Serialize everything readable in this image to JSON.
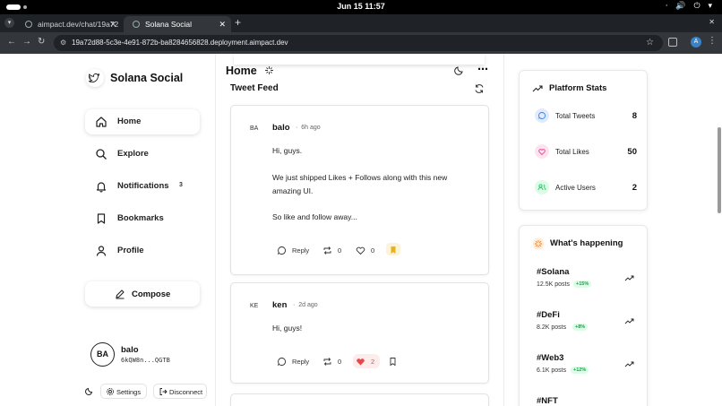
{
  "os": {
    "clock": "Jun 15  11:57",
    "tray": "⋅ 🔊 ⏻ ▾"
  },
  "browser": {
    "tabs": [
      {
        "label": "aimpact.dev/chat/19a72"
      },
      {
        "label": "Solana Social"
      }
    ],
    "url": "19a72d88-5c3e-4e91-872b-ba8284656828.deployment.aimpact.dev",
    "profile_initial": "A"
  },
  "sidebar": {
    "brand": "Solana Social",
    "items": [
      {
        "label": "Home",
        "icon": "home-icon"
      },
      {
        "label": "Explore",
        "icon": "search-icon"
      },
      {
        "label": "Notifications",
        "icon": "bell-icon",
        "badge": "3"
      },
      {
        "label": "Bookmarks",
        "icon": "bookmark-icon"
      },
      {
        "label": "Profile",
        "icon": "user-icon"
      }
    ],
    "compose_label": "Compose",
    "user": {
      "initials": "BA",
      "name": "balo",
      "address": "6kQW8n...QGTB"
    },
    "settings_label": "Settings",
    "disconnect_label": "Disconnect"
  },
  "main": {
    "title": "Home",
    "feed_title": "Tweet Feed",
    "tweets": [
      {
        "initials": "BA",
        "author": "balo",
        "time": "6h ago",
        "lines": [
          "Hi, guys.",
          "We just shipped Likes + Follows along with this new",
          "amazing UI.",
          "So like and follow away..."
        ],
        "reply_label": "Reply",
        "retweets": "0",
        "likes": "0"
      },
      {
        "initials": "KE",
        "author": "ken",
        "time": "2d ago",
        "lines": [
          "Hi, guys!"
        ],
        "reply_label": "Reply",
        "retweets": "0",
        "likes": "2"
      }
    ]
  },
  "stats": {
    "title": "Platform Stats",
    "rows": [
      {
        "label": "Total Tweets",
        "value": "8"
      },
      {
        "label": "Total Likes",
        "value": "50"
      },
      {
        "label": "Active Users",
        "value": "2"
      }
    ]
  },
  "trending": {
    "title": "What's happening",
    "items": [
      {
        "tag": "#Solana",
        "posts": "12.5K posts",
        "change": "+15%"
      },
      {
        "tag": "#DeFi",
        "posts": "8.2K posts",
        "change": "+8%"
      },
      {
        "tag": "#Web3",
        "posts": "6.1K posts",
        "change": "+12%"
      },
      {
        "tag": "#NFT"
      }
    ]
  },
  "colors": {
    "like_red": "#e5484d",
    "bookmark_gold": "#e9b21c",
    "stat_blue": "#3b82f6",
    "stat_pink": "#ec4899",
    "stat_green": "#22c55e",
    "trend_orange": "#f97316"
  }
}
